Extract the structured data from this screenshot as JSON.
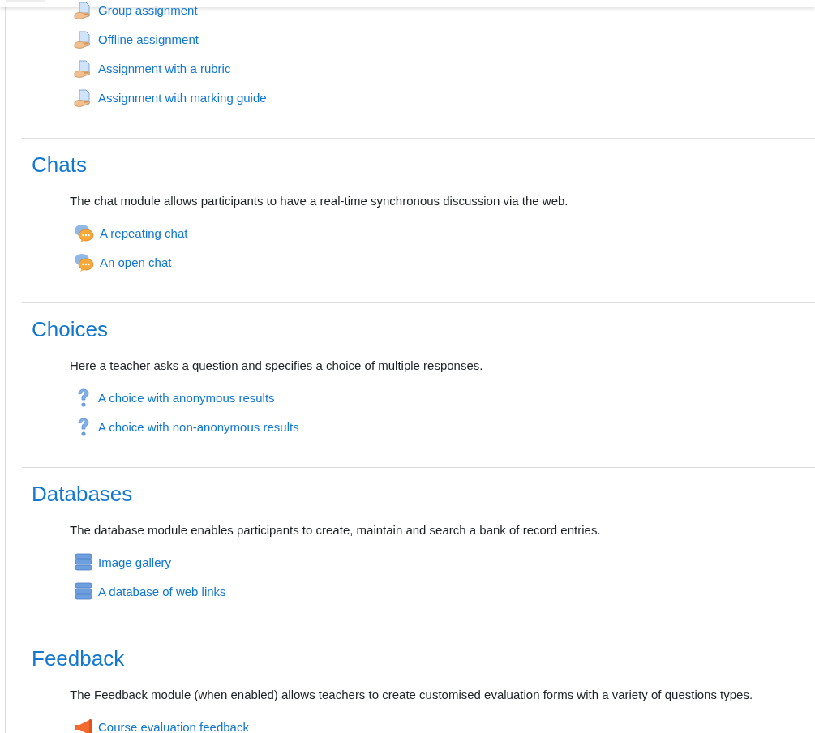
{
  "sections": [
    {
      "items": [
        {
          "kind": "assignment",
          "label": "Group assignment"
        },
        {
          "kind": "assignment",
          "label": "Offline assignment"
        },
        {
          "kind": "assignment",
          "label": "Assignment with a rubric"
        },
        {
          "kind": "assignment",
          "label": "Assignment with marking guide"
        }
      ]
    },
    {
      "heading": "Chats",
      "description": "The chat module allows participants to have a real-time synchronous discussion via the web.",
      "items": [
        {
          "kind": "chat",
          "label": "A repeating chat"
        },
        {
          "kind": "chat",
          "label": "An open chat"
        }
      ]
    },
    {
      "heading": "Choices",
      "description": "Here a teacher asks a question and specifies a choice of multiple responses.",
      "items": [
        {
          "kind": "choice",
          "label": "A choice with anonymous results"
        },
        {
          "kind": "choice",
          "label": "A choice with non-anonymous results"
        }
      ]
    },
    {
      "heading": "Databases",
      "description": "The database module enables participants to create, maintain and search a bank of record entries.",
      "items": [
        {
          "kind": "database",
          "label": "Image gallery"
        },
        {
          "kind": "database",
          "label": "A database of web links"
        }
      ]
    },
    {
      "heading": "Feedback",
      "description": "The Feedback module (when enabled) allows teachers to create customised evaluation forms with a variety of questions types.",
      "items": [
        {
          "kind": "feedback",
          "label": "Course evaluation feedback"
        }
      ]
    }
  ]
}
